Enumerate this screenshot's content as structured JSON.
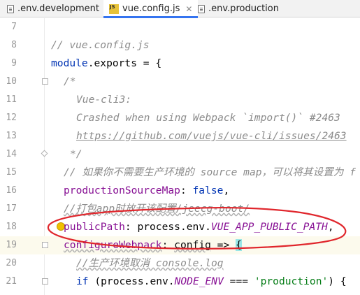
{
  "tabs": [
    {
      "label": ".env.development",
      "icon": "file-icon",
      "active": false
    },
    {
      "label": "vue.config.js",
      "icon": "js-file-icon",
      "active": true
    },
    {
      "label": ".env.production",
      "icon": "file-icon",
      "active": false
    }
  ],
  "lines": [
    {
      "number": "7"
    },
    {
      "number": "8",
      "text": "// vue.config.js"
    },
    {
      "number": "9",
      "kw": "module",
      "rest": ".exports = {"
    },
    {
      "number": "10",
      "text": "/*"
    },
    {
      "number": "11",
      "text": "Vue-cli3:"
    },
    {
      "number": "12",
      "text": "Crashed when using Webpack `import()` #2463"
    },
    {
      "number": "13",
      "text": "https://github.com/vuejs/vue-cli/issues/2463"
    },
    {
      "number": "14",
      "text": "*/"
    },
    {
      "number": "15",
      "text": "// 如果你不需要生产环境的 source map，可以将其设置为 f"
    },
    {
      "number": "16",
      "prop": "productionSourceMap",
      "sep": ": ",
      "value": "false",
      "end": ","
    },
    {
      "number": "17",
      "text": "//打包app时放开该配置/jeecg-boot/"
    },
    {
      "number": "18",
      "prop": "publicPath",
      "sep": ": ",
      "obj": "process.env.",
      "const": "VUE_APP_PUBLIC_PATH",
      "end": ","
    },
    {
      "number": "19",
      "prop": "configureWebpack",
      "sep": ": ",
      "param": "config",
      "arrow": " => ",
      "brace": "{"
    },
    {
      "number": "20",
      "text": "//生产环境取消 console.log"
    },
    {
      "number": "21",
      "kw": "if",
      "pre": " (process.env.",
      "const": "NODE_ENV",
      "mid": " === ",
      "str": "'production'",
      "end": ") {"
    }
  ]
}
